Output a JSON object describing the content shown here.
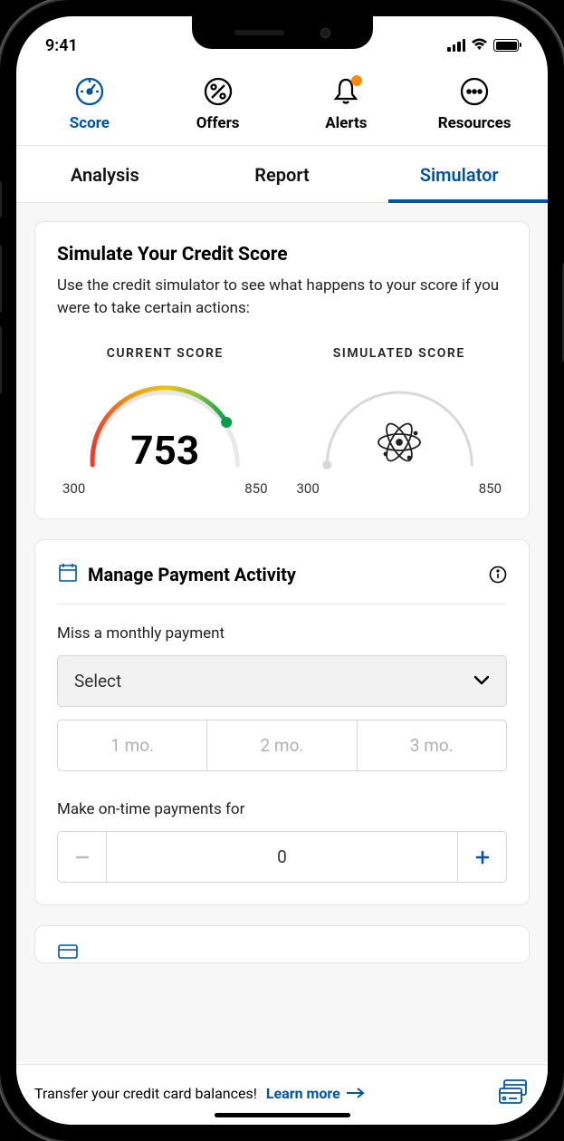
{
  "status": {
    "time": "9:41"
  },
  "topNav": [
    {
      "label": "Score",
      "icon": "gauge"
    },
    {
      "label": "Offers",
      "icon": "percent"
    },
    {
      "label": "Alerts",
      "icon": "bell"
    },
    {
      "label": "Resources",
      "icon": "dots"
    }
  ],
  "subTabs": [
    "Analysis",
    "Report",
    "Simulator"
  ],
  "simulate": {
    "title": "Simulate Your Credit Score",
    "desc": "Use the credit simulator to see what happens to your score if you were to take certain actions:",
    "current": {
      "label": "CURRENT SCORE",
      "value": "753",
      "min": "300",
      "max": "850"
    },
    "simulated": {
      "label": "SIMULATED SCORE",
      "min": "300",
      "max": "850"
    }
  },
  "payment": {
    "title": "Manage Payment Activity",
    "missLabel": "Miss a monthly payment",
    "selectPlaceholder": "Select",
    "months": [
      "1 mo.",
      "2 mo.",
      "3 mo."
    ],
    "ontimeLabel": "Make on-time payments for",
    "ontimeValue": "0"
  },
  "banner": {
    "text": "Transfer your credit card balances!",
    "cta": "Learn more"
  },
  "colors": {
    "primary": "#0054a4",
    "badge": "#ff8c00"
  }
}
